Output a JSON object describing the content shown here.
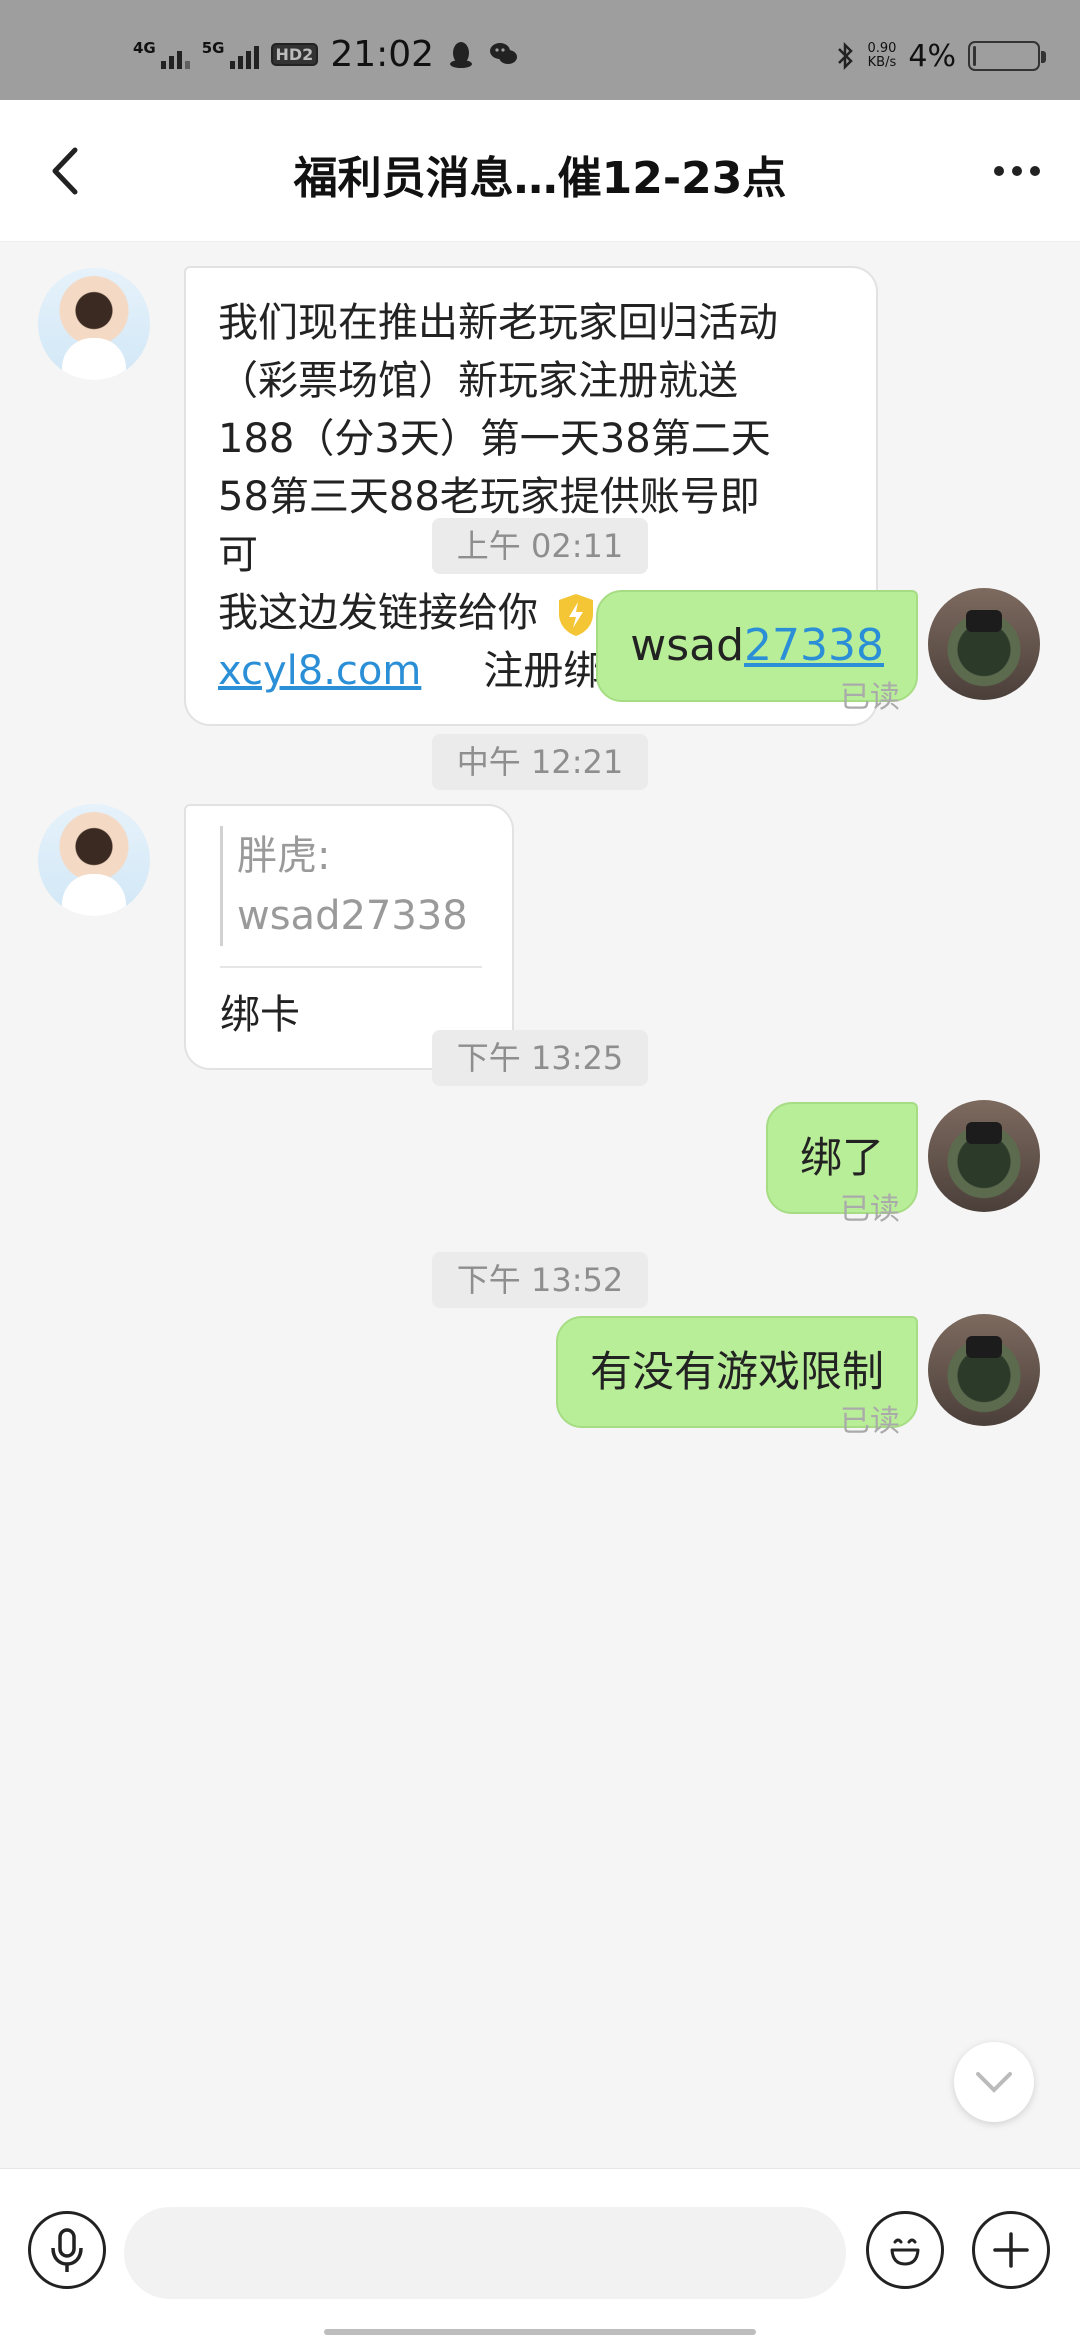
{
  "status_bar": {
    "net1": "4G",
    "net2": "5G",
    "hd": "HD2",
    "time": "21:02",
    "speed_value": "0.90",
    "speed_unit": "KB/s",
    "battery": "4%",
    "battery_level": 0.04
  },
  "header": {
    "title": "福利员消息…催12-23点"
  },
  "messages": {
    "m1": {
      "lines": [
        "我们现在推出新老玩家回归活动",
        "（彩票场馆）新玩家注册就送",
        "188（分3天）第一天38第二天",
        "58第三天88老玩家提供账号即",
        "可"
      ],
      "line6": "我这边发链接给你",
      "link": "xcyl8.com",
      "link_suffix": "注册绑卡领取"
    },
    "ts1": "上午 02:11",
    "m2": {
      "prefix": "wsad",
      "link": "27338",
      "status": "已读"
    },
    "ts2": "中午 12:21",
    "m3": {
      "quote_name": "胖虎:",
      "quote_text": "wsad27338",
      "text": "绑卡"
    },
    "ts3": "下午 13:25",
    "m4": {
      "text": "绑了",
      "status": "已读"
    },
    "ts4": "下午 13:52",
    "m5": {
      "text": "有没有游戏限制",
      "status": "已读"
    }
  },
  "input": {
    "placeholder": ""
  },
  "colors": {
    "outgoing_bubble": "#b9ee98",
    "link": "#2a8fd6",
    "status_bar": "#9e9e9e"
  }
}
